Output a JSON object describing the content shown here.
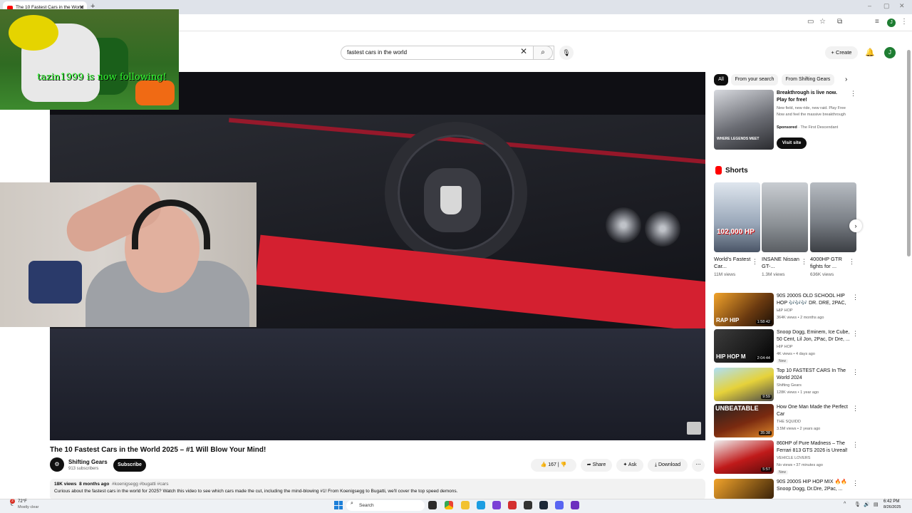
{
  "browser": {
    "tab_title": "The 10 Fastest Cars in the World",
    "new_tab": "+",
    "window_controls": [
      "–",
      "▢",
      "✕"
    ]
  },
  "header": {
    "search_value": "fastest cars in the world",
    "create_label": "Create",
    "avatar_letter": "J"
  },
  "overlay": {
    "follow_text": "tazin1999 is now following!"
  },
  "video": {
    "title": "The 10 Fastest Cars in the World 2025 – #1 Will Blow Your Mind!",
    "channel_name": "Shifting Gears",
    "subscribers": "913 subscribers",
    "subscribe_label": "Subscribe",
    "likes": "167",
    "share_label": "Share",
    "ask_label": "Ask",
    "download_label": "Download",
    "views": "18K views",
    "age": "8 months ago",
    "tags": "#koenigsegg #bugatti #cars",
    "description": "Curious about the fastest cars in the world for 2025? Watch this video to see which cars made the cut, including the mind-blowing #1! From Koenigsegg to Bugatti, we'll cover the top speed demons."
  },
  "sidebar": {
    "chips": [
      "All",
      "From your search",
      "From Shifting Gears"
    ],
    "ad": {
      "title": "Breakthrough is live now. Play for free!",
      "description": "New field, new ride, new raid. Play Free Now and feel the massive breakthrough",
      "sponsored": "Sponsored",
      "advertiser": "· The First Descendant",
      "visit_label": "Visit site",
      "thumb_text": "WHERE LEGENDS MEET"
    },
    "shorts_heading": "Shorts",
    "shorts": [
      {
        "title": "World's Fastest Car...",
        "views": "11M views",
        "overlay": "102,000 HP"
      },
      {
        "title": "INSANE Nissan GT-...",
        "views": "1.3M views",
        "overlay": ""
      },
      {
        "title": "4000HP GTR fights for ...",
        "views": "636K views",
        "overlay": ""
      }
    ],
    "recommendations": [
      {
        "title": "90S 2000S OLD SCHOOL HIP HOP 🎶🎶🎶 DR. DRE, 2PAC, ...",
        "channel": "HIP HOP",
        "meta": "364K views • 2 months ago",
        "duration": "1:58:42",
        "badge": ""
      },
      {
        "title": "Snoop Dogg, Eminem, Ice Cube, 50 Cent, Lil Jon, 2Pac, Dr Dre, ...",
        "channel": "HIP HOP",
        "meta": "4K views • 4 days ago",
        "duration": "2:04:44",
        "badge": "New"
      },
      {
        "title": "Top 10 FASTEST CARS In The World 2024",
        "channel": "Shifting Gears",
        "meta": "128K views • 1 year ago",
        "duration": "9:59",
        "badge": ""
      },
      {
        "title": "How One Man Made the Perfect Car",
        "channel": "THE SQUIDD",
        "meta": "3.5M views • 2 years ago",
        "duration": "35:38",
        "badge": ""
      },
      {
        "title": "860HP of Pure Madness – The Ferrari 813 GTS 2026 is Unreal!",
        "channel": "VEHICLE LOVERS",
        "meta": "No views • 37 minutes ago",
        "duration": "5:57",
        "badge": "New"
      },
      {
        "title": "90S 2000S HIP HOP MIX 🔥🔥 Snoop Dogg, Dr.Dre, 2Pac, ...",
        "channel": "",
        "meta": "",
        "duration": "",
        "badge": ""
      }
    ],
    "rec_thumb_texts": [
      "RAP HIP",
      "HIP HOP M",
      "",
      "UNBEATABLE",
      "",
      ""
    ]
  },
  "taskbar": {
    "weather_temp": "72°F",
    "weather_cond": "Mostly clear",
    "search_label": "Search",
    "time": "6:42 PM",
    "date": "8/26/2025",
    "notification_count": "2"
  },
  "colors": {
    "accent_red": "#ff0000",
    "subscribe_bg": "#0f0f0f",
    "follow_text": "#31ff31",
    "avatar_green": "#1e7d32"
  }
}
